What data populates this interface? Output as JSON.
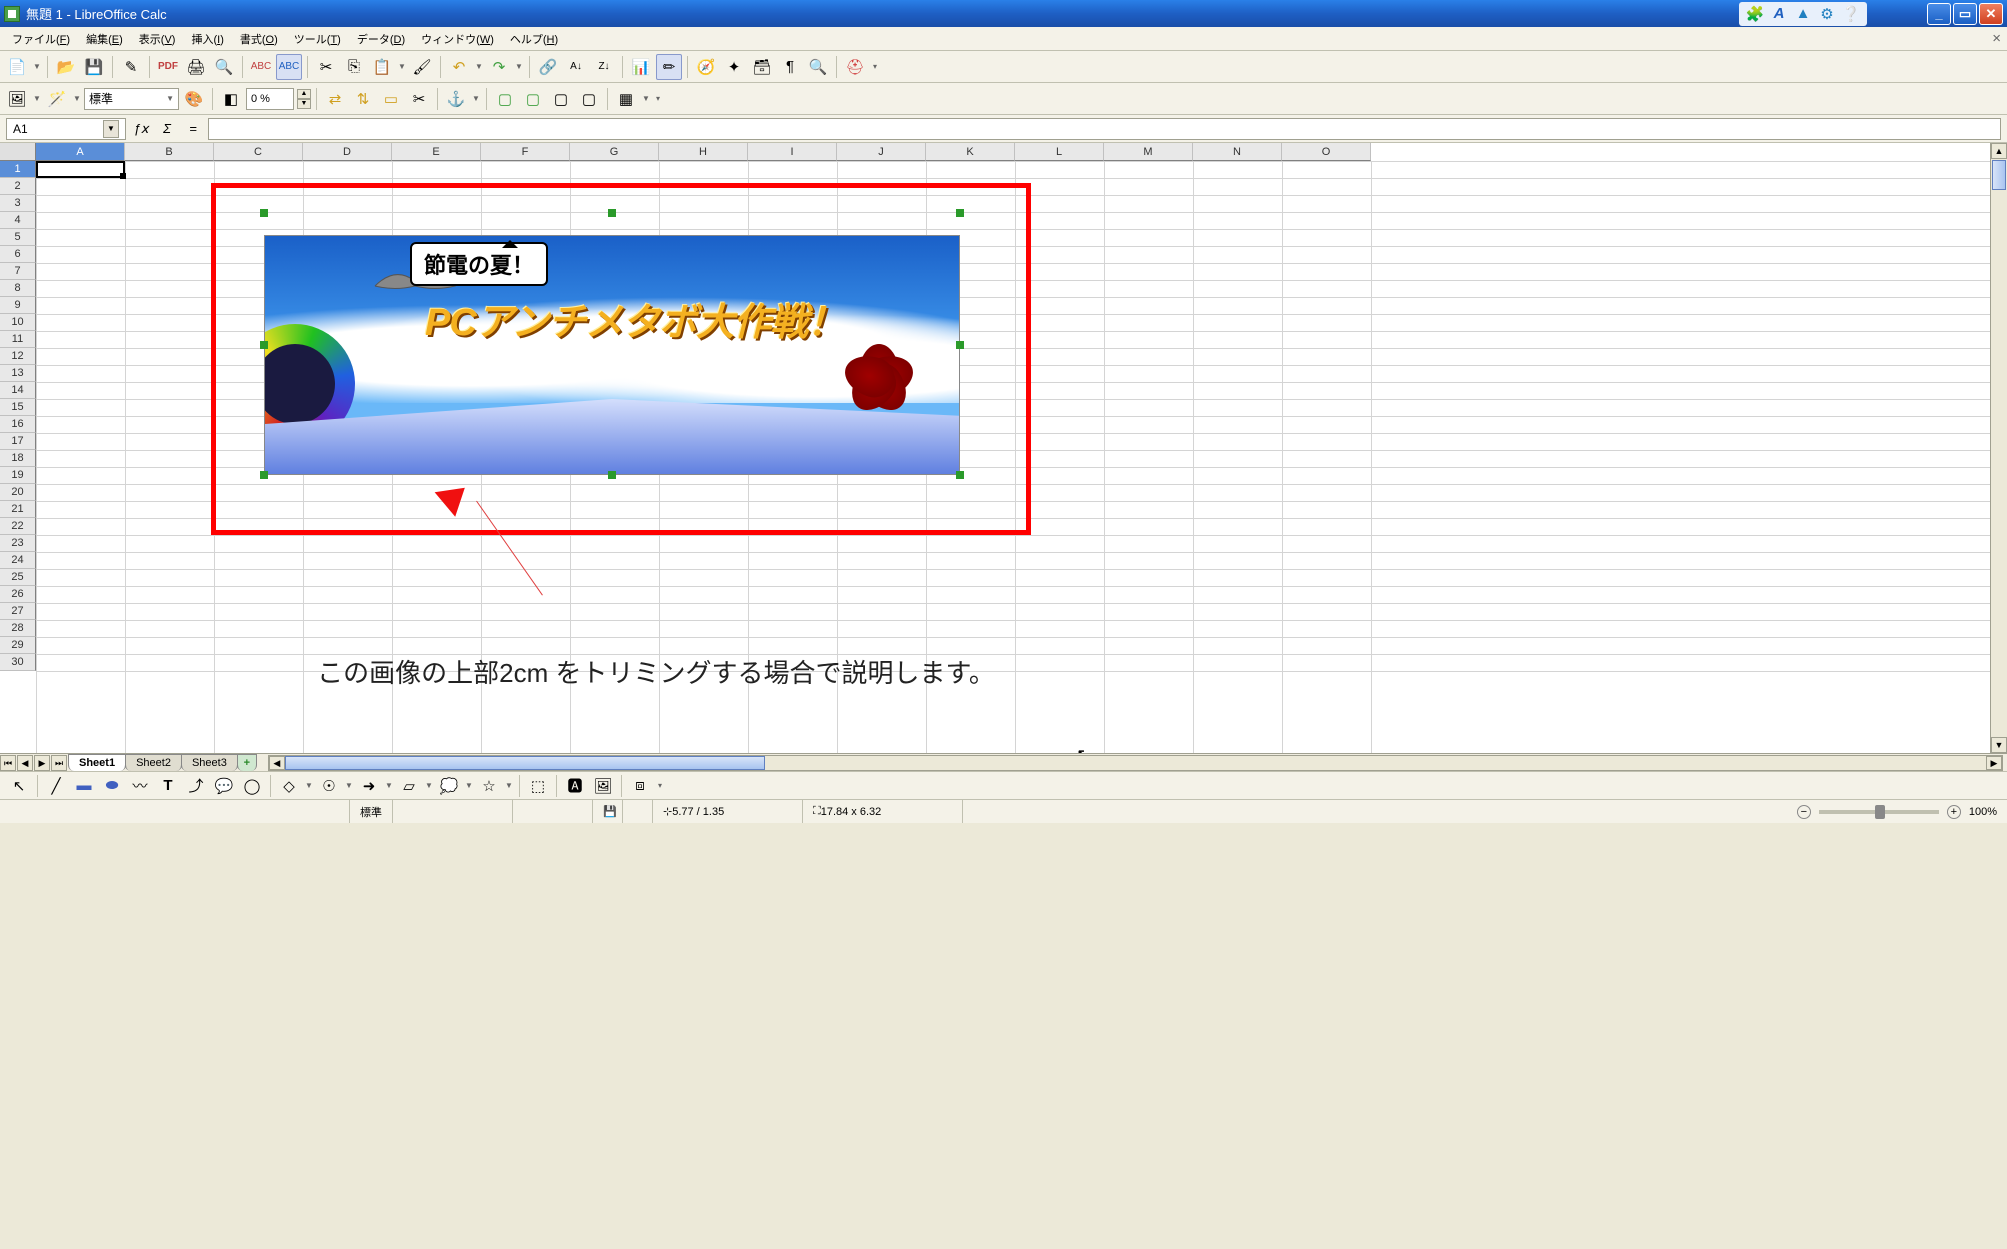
{
  "window": {
    "title": "無題 1 - LibreOffice Calc"
  },
  "menubar": {
    "items": [
      {
        "label": "ファイル",
        "accel": "F"
      },
      {
        "label": "編集",
        "accel": "E"
      },
      {
        "label": "表示",
        "accel": "V"
      },
      {
        "label": "挿入",
        "accel": "I"
      },
      {
        "label": "書式",
        "accel": "O"
      },
      {
        "label": "ツール",
        "accel": "T"
      },
      {
        "label": "データ",
        "accel": "D"
      },
      {
        "label": "ウィンドウ",
        "accel": "W"
      },
      {
        "label": "ヘルプ",
        "accel": "H"
      }
    ]
  },
  "toolbar2": {
    "style_label": "標準",
    "percent_label": "0 %"
  },
  "formula_bar": {
    "cell_ref": "A1",
    "formula_value": ""
  },
  "columns": [
    "A",
    "B",
    "C",
    "D",
    "E",
    "F",
    "G",
    "H",
    "I",
    "J",
    "K",
    "L",
    "M",
    "N",
    "O"
  ],
  "rows_count": 30,
  "selected_cell": {
    "col": 0,
    "row": 0
  },
  "image_overlay": {
    "speech_text": "節電の夏！",
    "main_text": "PCアンチメタボ大作戦！"
  },
  "caption_text": "この画像の上部2cm をトリミングする場合で説明します。",
  "sheet_tabs": {
    "tabs": [
      {
        "label": "Sheet1",
        "active": true
      },
      {
        "label": "Sheet2",
        "active": false
      },
      {
        "label": "Sheet3",
        "active": false
      }
    ]
  },
  "statusbar": {
    "mode": "標準",
    "pos": "5.77 / 1.35",
    "size": "17.84 x 6.32",
    "zoom": "100%"
  }
}
